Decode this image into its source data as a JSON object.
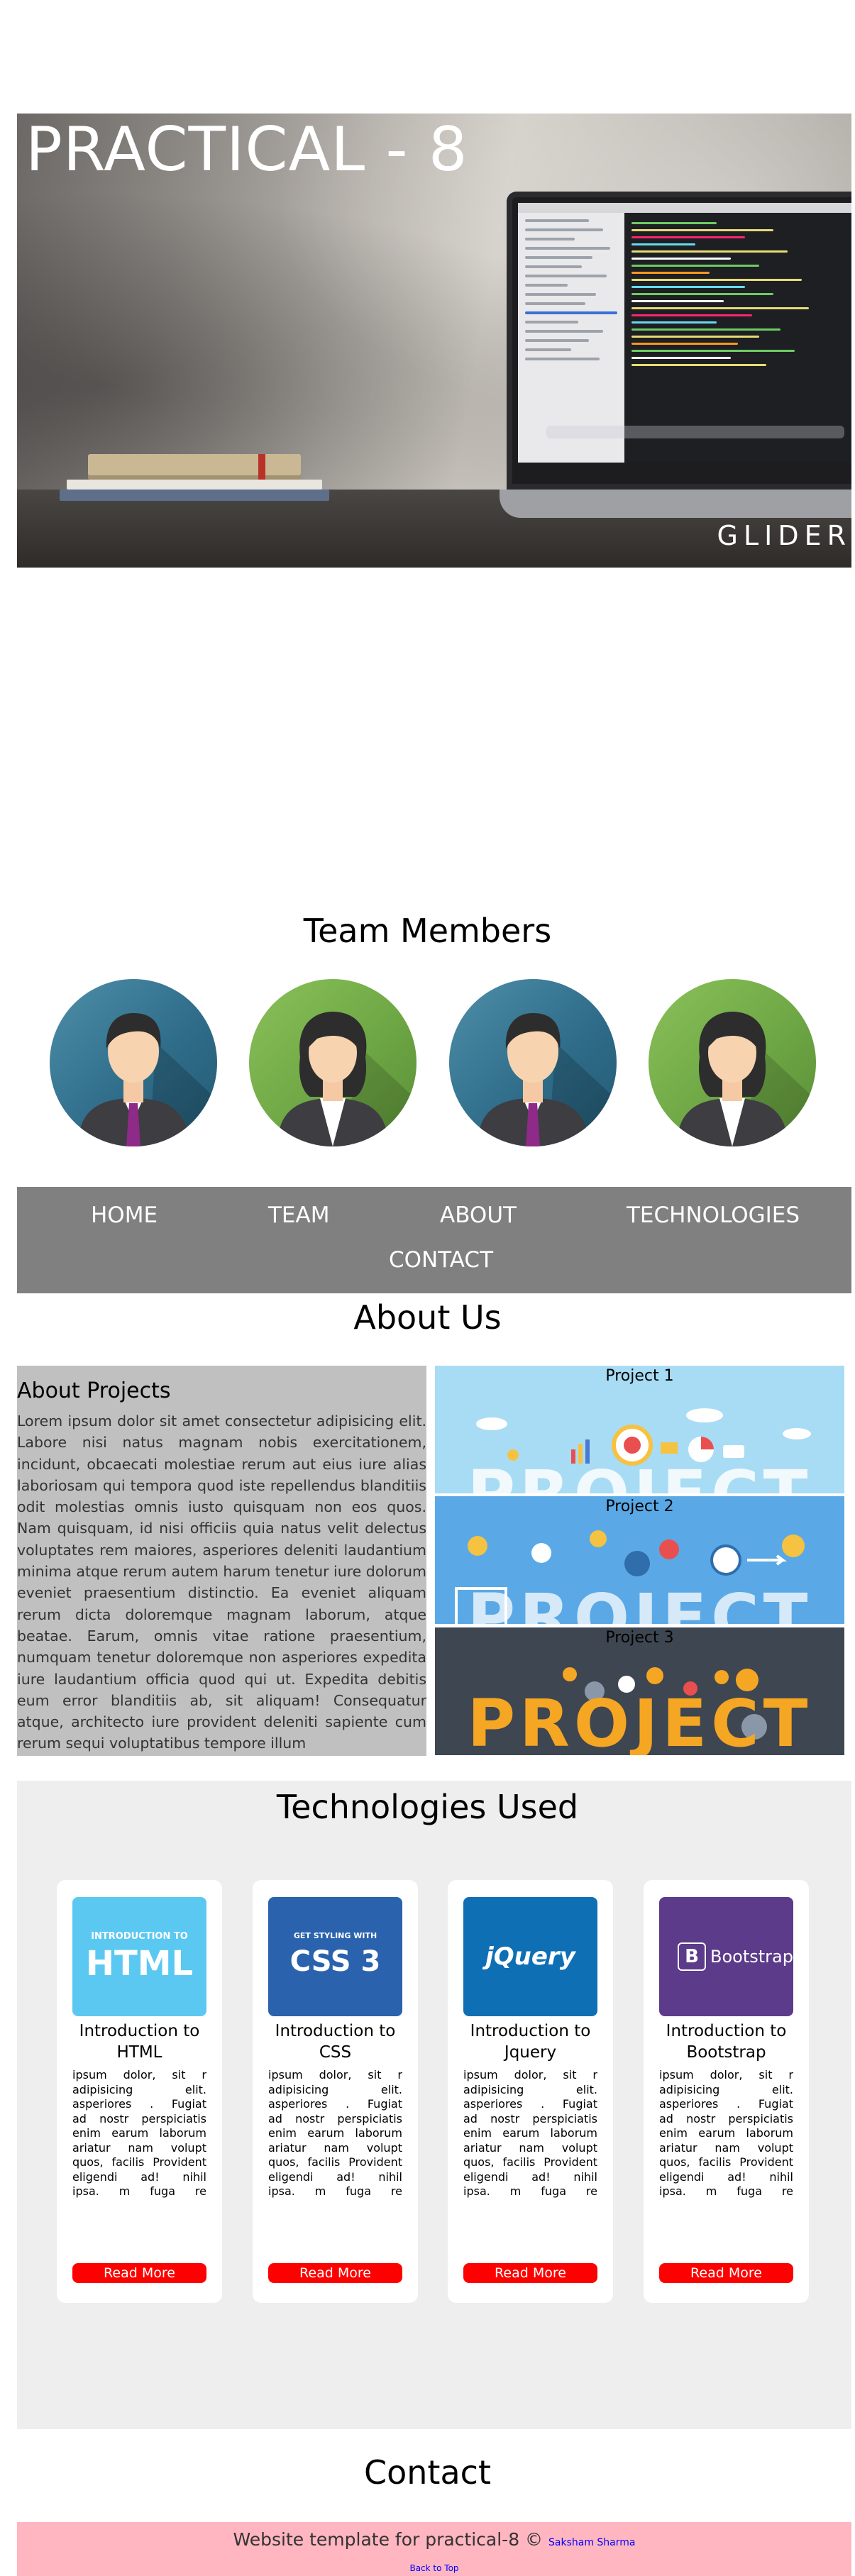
{
  "hero": {
    "title": "PRACTICAL - 8",
    "watermark": "GLIDER"
  },
  "team": {
    "heading": "Team Members",
    "members": [
      {
        "gender": "male",
        "color": "#3f7f9c"
      },
      {
        "gender": "female",
        "color": "#7ab44f"
      },
      {
        "gender": "male",
        "color": "#3f7f9c"
      },
      {
        "gender": "female",
        "color": "#7ab44f"
      }
    ]
  },
  "nav": {
    "items": [
      "HOME",
      "TEAM",
      "ABOUT",
      "TECHNOLOGIES",
      "CONTACT"
    ],
    "background": "#808080"
  },
  "about": {
    "heading": "About Us",
    "projects_heading": "About Projects",
    "text": "Lorem ipsum dolor sit amet consectetur adipisicing elit. Labore nisi natus magnam nobis exercitationem, incidunt, obcaecati molestiae rerum aut eius iure alias laboriosam qui tempora quod iste repellendus blanditiis odit molestias omnis iusto quisquam non eos quos. Nam quisquam, id nisi officiis quia natus velit delectus voluptates rem maiores, asperiores deleniti laudantium minima atque rerum autem harum tenetur iure dolorum eveniet praesentium distinctio. Ea eveniet aliquam rerum dicta doloremque magnam laborum, atque beatae. Earum, omnis vitae ratione praesentium, numquam tenetur doloremque non asperiores expedita iure laudantium officia quod qui ut. Expedita debitis eum error blanditiis ab, sit aliquam! Consequatur atque, architecto iure provident deleniti sapiente cum rerum sequi voluptatibus tempore illum",
    "project_image_word": "PROJECT",
    "projects": [
      {
        "label": "Project 1",
        "bg": "#a8dcf5"
      },
      {
        "label": "Project 2",
        "bg": "#5aa9e6"
      },
      {
        "label": "Project 3",
        "bg": "#3e4651"
      }
    ]
  },
  "technologies": {
    "heading": "Technologies Used",
    "cards": [
      {
        "logo_top": "INTRODUCTION TO",
        "logo_main": "HTML",
        "title_line1": "Introduction to",
        "title_line2": "HTML",
        "logo_bg": "#5bc8f2"
      },
      {
        "logo_top": "GET STYLING WITH",
        "logo_main": "CSS 3",
        "title_line1": "Introduction to",
        "title_line2": "CSS",
        "logo_bg": "#2a62ad"
      },
      {
        "logo_top": "",
        "logo_main": "jQuery",
        "title_line1": "Introduction to",
        "title_line2": "Jquery",
        "logo_bg": "#0f6fb5"
      },
      {
        "logo_top": "",
        "logo_main": "Bootstrap",
        "title_line1": "Introduction to",
        "title_line2": "Bootstrap",
        "logo_bg": "#5c3b8a"
      }
    ],
    "card_text": "ipsum dolor, sit r adipisicing elit. asperiores . Fugiat ad nostr perspiciatis enim earum laborum ariatur nam volupt quos, facilis Provident eligendi ad! nihil ipsa. m fuga re",
    "button_label": "Read More",
    "button_color": "#ff0000"
  },
  "contact": {
    "heading": "Contact"
  },
  "footer": {
    "text": "Website template for practical-8 ©",
    "author": "Saksham Sharma",
    "back_to_top": "Back to Top",
    "background": "#ffb6c1"
  }
}
